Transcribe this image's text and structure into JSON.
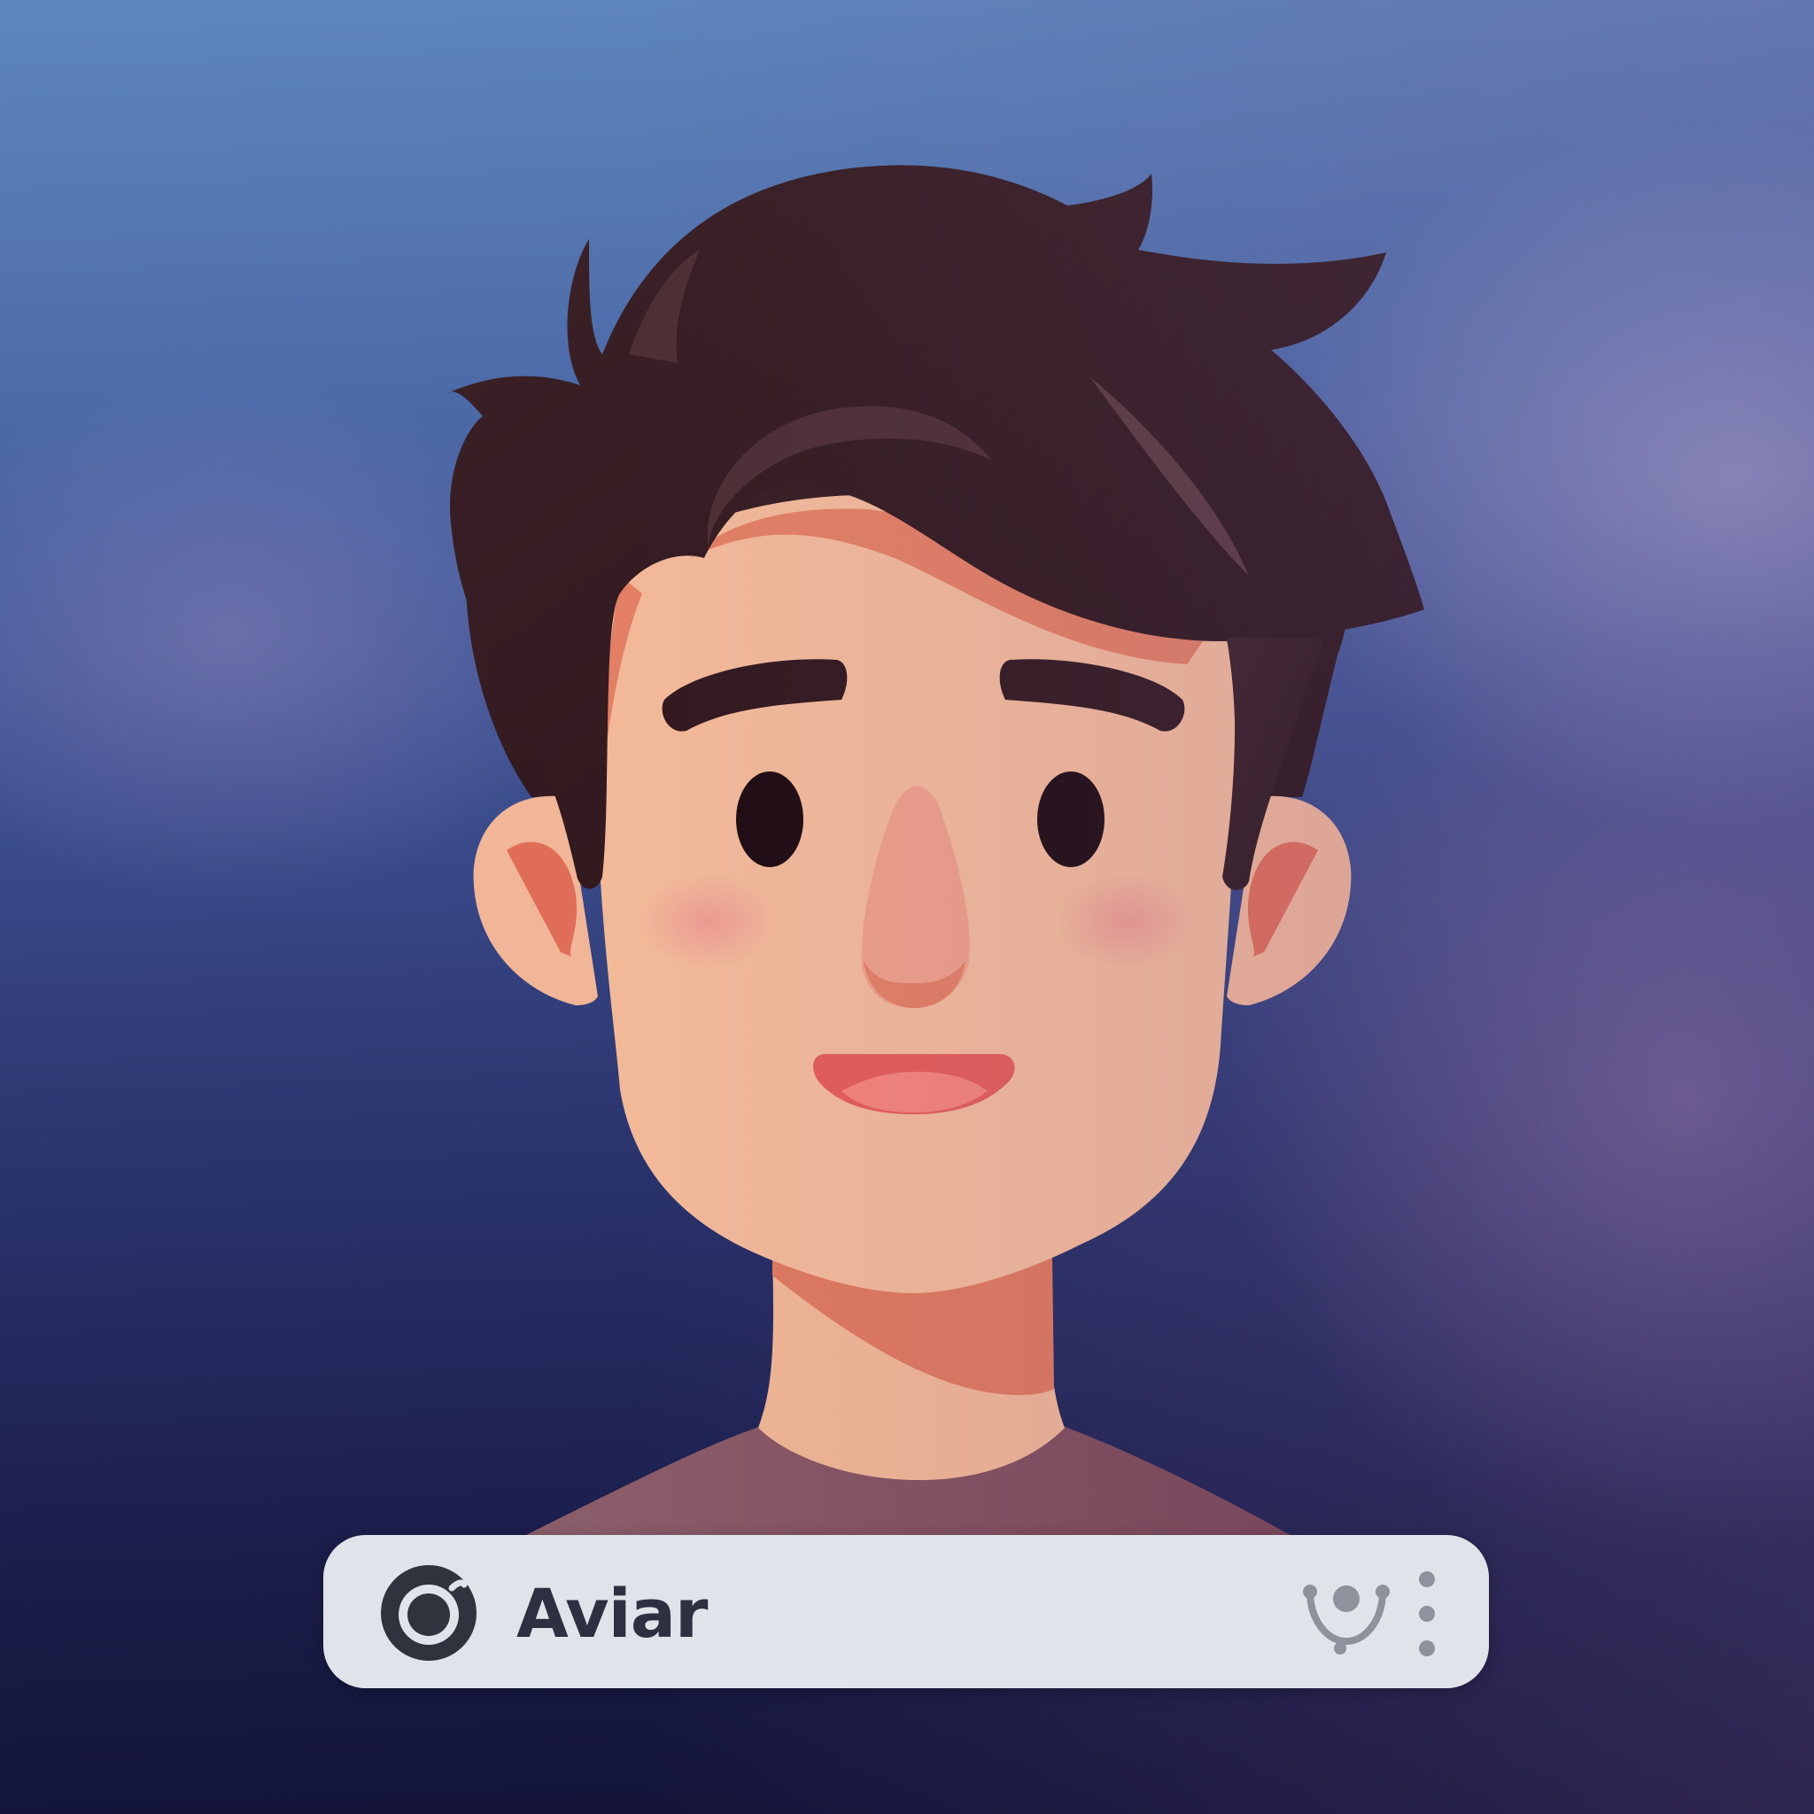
{
  "app": {
    "name": "Aviar"
  },
  "icons": {
    "logo": "ring-logo-icon",
    "companion": "avatar-companion-icon",
    "more": "vertical-dots-icon"
  },
  "colors": {
    "bar_background": "#e1e3ea",
    "text": "#2c3040",
    "icon_dark": "#2f333d",
    "icon_gray": "#8e929c",
    "hair": "#33191f",
    "skin": "#f0b898",
    "shirt": "#845660"
  }
}
